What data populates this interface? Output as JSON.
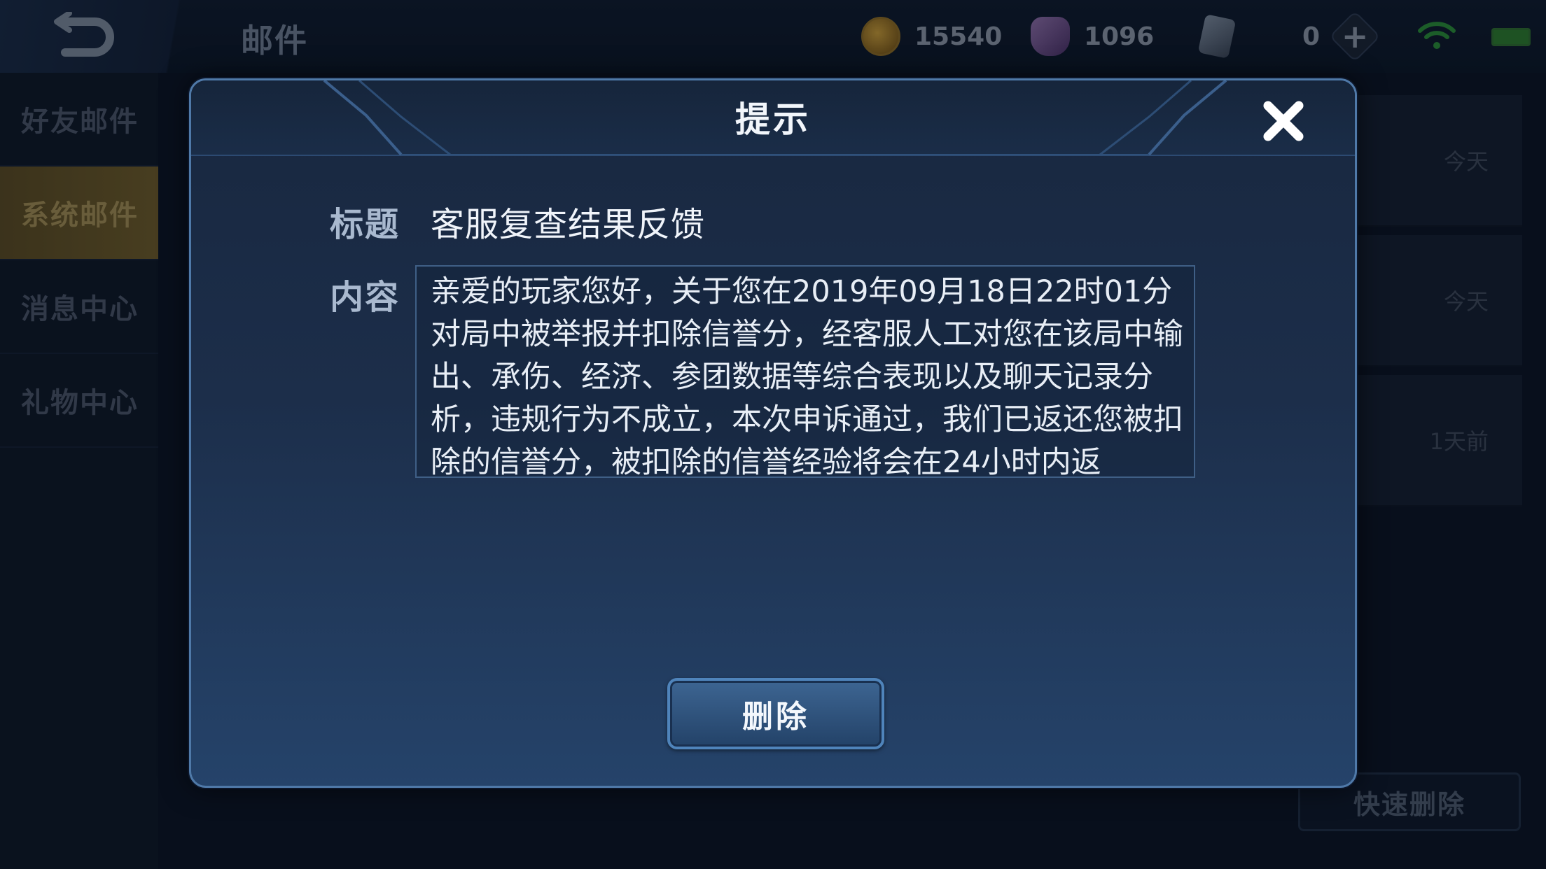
{
  "app": {
    "page_title": "邮件"
  },
  "status_bar": {
    "coins": "15540",
    "gems": "1096",
    "tickets": "0",
    "coin_icon": "coin-icon",
    "gem_icon": "gem-icon",
    "ticket_icon": "card-icon",
    "plus_label": "+"
  },
  "sidebar": {
    "items": [
      {
        "label": "好友邮件"
      },
      {
        "label": "系统邮件"
      },
      {
        "label": "消息中心"
      },
      {
        "label": "礼物中心"
      }
    ]
  },
  "mail_list": {
    "times": [
      "今天",
      "今天",
      "1天前"
    ],
    "quick_delete_label": "快速删除"
  },
  "dialog": {
    "title": "提示",
    "subject_label": "标题",
    "subject": "客服复查结果反馈",
    "content_label": "内容",
    "content": "亲爱的玩家您好，关于您在2019年09月18日22时01分对局中被举报并扣除信誉分，经客服人工对您在该局中输出、承伤、经济、参团数据等综合表现以及聊天记录分析，违规行为不成立，本次申诉通过，我们已返还您被扣除的信誉分，被扣除的信誉经验将会在24小时内返",
    "delete_label": "删除"
  },
  "colors": {
    "accent": "#4f79a8",
    "active_tab": "#6d5a28",
    "dialog_bg": "#1c2e4a"
  }
}
